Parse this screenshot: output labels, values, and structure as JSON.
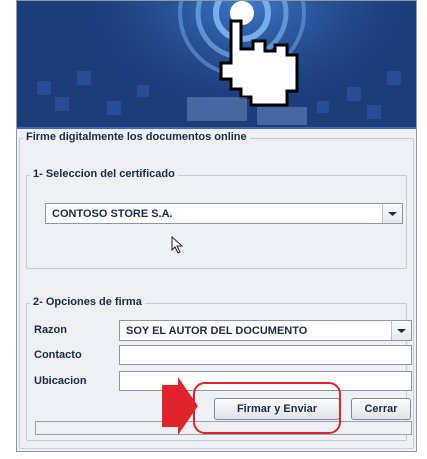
{
  "window": {
    "panel_title": "Firme digitalmente los documentos online"
  },
  "certificate_section": {
    "title": "1- Seleccion del certificado",
    "selected_certificate": "CONTOSO STORE S.A."
  },
  "signature_section": {
    "title": "2- Opciones de firma",
    "reason_label": "Razon",
    "reason_value": "SOY EL AUTOR DEL DOCUMENTO",
    "contact_label": "Contacto",
    "contact_value": "",
    "location_label": "Ubicacion",
    "location_value": ""
  },
  "buttons": {
    "sign_send": "Firmar y Enviar",
    "close": "Cerrar"
  },
  "progress": {
    "fraction": 0
  },
  "colors": {
    "banner_blue": "#1b3a78",
    "annotation_red": "#e0232a"
  },
  "icons": {
    "banner": "pointing-hand-icon",
    "combo_arrow": "chevron-down-icon",
    "mouse": "mouse-cursor-icon",
    "annotation": "red-arrow-icon"
  }
}
